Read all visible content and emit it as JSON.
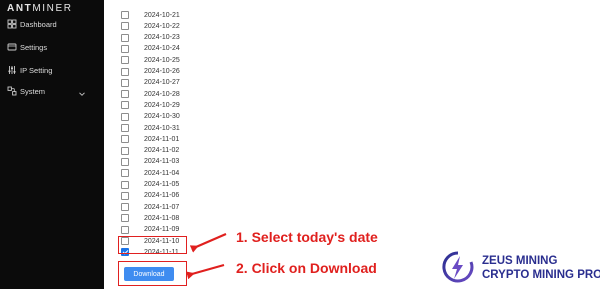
{
  "sidebar": {
    "brand_bold": "ANT",
    "brand_light": "MINER",
    "items": [
      {
        "label": "Dashboard",
        "icon": "dashboard-icon"
      },
      {
        "label": "Settings",
        "icon": "settings-icon"
      },
      {
        "label": "IP Setting",
        "icon": "ip-setting-icon"
      },
      {
        "label": "System",
        "icon": "system-icon"
      }
    ]
  },
  "dates": [
    {
      "label": "2024-10-21",
      "checked": false
    },
    {
      "label": "2024-10-22",
      "checked": false
    },
    {
      "label": "2024-10-23",
      "checked": false
    },
    {
      "label": "2024-10-24",
      "checked": false
    },
    {
      "label": "2024-10-25",
      "checked": false
    },
    {
      "label": "2024-10-26",
      "checked": false
    },
    {
      "label": "2024-10-27",
      "checked": false
    },
    {
      "label": "2024-10-28",
      "checked": false
    },
    {
      "label": "2024-10-29",
      "checked": false
    },
    {
      "label": "2024-10-30",
      "checked": false
    },
    {
      "label": "2024-10-31",
      "checked": false
    },
    {
      "label": "2024-11-01",
      "checked": false
    },
    {
      "label": "2024-11-02",
      "checked": false
    },
    {
      "label": "2024-11-03",
      "checked": false
    },
    {
      "label": "2024-11-04",
      "checked": false
    },
    {
      "label": "2024-11-05",
      "checked": false
    },
    {
      "label": "2024-11-06",
      "checked": false
    },
    {
      "label": "2024-11-07",
      "checked": false
    },
    {
      "label": "2024-11-08",
      "checked": false
    },
    {
      "label": "2024-11-09",
      "checked": false
    },
    {
      "label": "2024-11-10",
      "checked": false
    },
    {
      "label": "2024-11-11",
      "checked": true
    }
  ],
  "download_label": "Download",
  "annotations": {
    "step1": "1. Select today's date",
    "step2": "2. Click on Download"
  },
  "watermark": {
    "line1": "ZEUS MINING",
    "line2": "CRYPTO MINING PRO"
  },
  "colors": {
    "sidebar_bg": "#0b0b0b",
    "annotation_red": "#e0201e",
    "button_blue": "#3f8cf0",
    "logo_navy": "#2a2e8f",
    "logo_purple": "#6a4bc4"
  }
}
